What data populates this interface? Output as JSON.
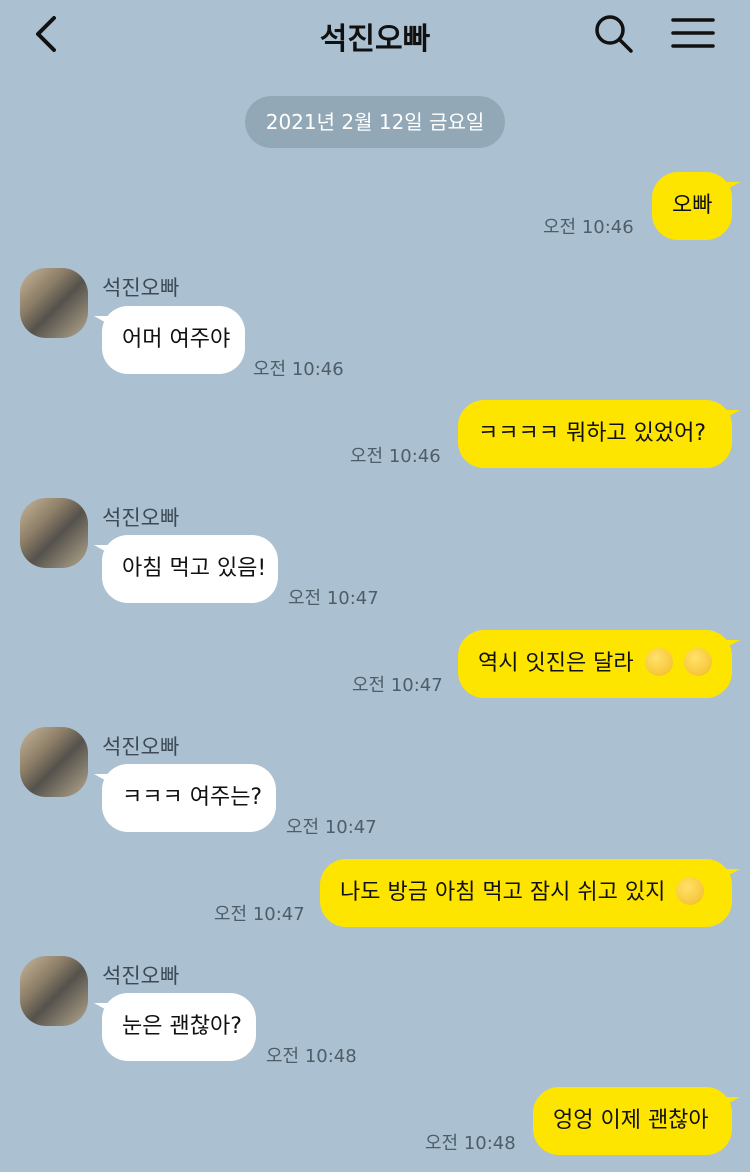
{
  "header": {
    "title": "석진오빠",
    "back_icon": "chevron-left-icon",
    "search_icon": "search-icon",
    "menu_icon": "hamburger-menu-icon"
  },
  "date_divider": "2021년 2월 12일 금요일",
  "colors": {
    "background": "#abc1d1",
    "outgoing_bubble": "#fee500",
    "incoming_bubble": "#ffffff",
    "date_pill": "#93a8b7"
  },
  "messages": [
    {
      "direction": "out",
      "text": "오빠",
      "time": "오전 10:46"
    },
    {
      "direction": "in",
      "sender": "석진오빠",
      "text": "어머 여주야",
      "time": "오전 10:46"
    },
    {
      "direction": "out",
      "text": "ㅋㅋㅋㅋ 뭐하고 있었어?",
      "time": "오전 10:46"
    },
    {
      "direction": "in",
      "sender": "석진오빠",
      "text": "아침 먹고 있음!",
      "time": "오전 10:47"
    },
    {
      "direction": "out",
      "text": "역시 잇진은 달라",
      "emoji": [
        "laughing-face-emoji",
        "laughing-face-emoji"
      ],
      "time": "오전 10:47"
    },
    {
      "direction": "in",
      "sender": "석진오빠",
      "text": "ㅋㅋㅋ 여주는?",
      "time": "오전 10:47"
    },
    {
      "direction": "out",
      "text": "나도 방금 아침 먹고 잠시 쉬고 있지",
      "emoji": [
        "smiling-face-emoji"
      ],
      "time": "오전 10:47"
    },
    {
      "direction": "in",
      "sender": "석진오빠",
      "text": "눈은 괜찮아?",
      "time": "오전 10:48"
    },
    {
      "direction": "out",
      "text": "엉엉 이제 괜찮아",
      "time": "오전 10:48"
    }
  ]
}
